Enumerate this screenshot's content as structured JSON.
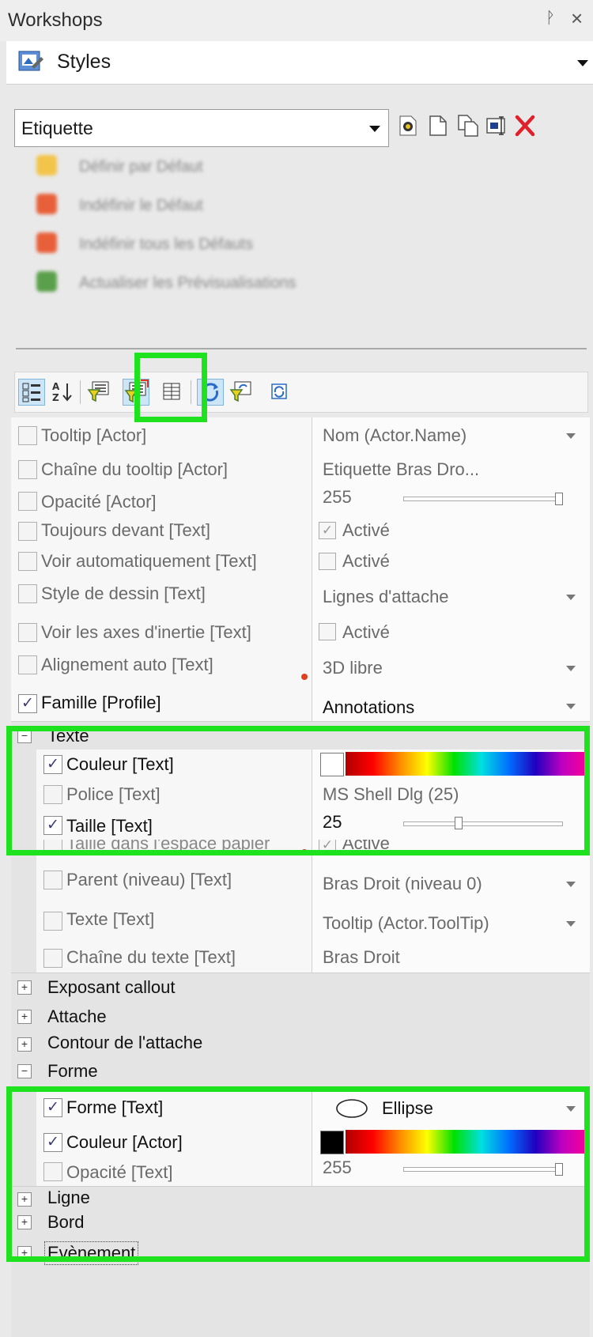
{
  "window": {
    "title": "Workshops",
    "pin_glyph": "ᚹ",
    "close_glyph": "×"
  },
  "styles_combo": {
    "label": "Styles",
    "icon": "styles-workshop-icon"
  },
  "style_selector": {
    "value": "Etiquette",
    "toolbar_icons": [
      "edit-style-icon",
      "new-style-icon",
      "copy-style-icon",
      "rename-style-icon",
      "delete-style-icon"
    ]
  },
  "blurred_actions": [
    {
      "label": "Définir par Défaut",
      "icon_color": "#f3c44a"
    },
    {
      "label": "Indéfinir le Défaut",
      "icon_color": "#e8603a"
    },
    {
      "label": "Indéfinir tous les Défauts",
      "icon_color": "#e8603a"
    },
    {
      "label": "Actualiser les Prévisualisations",
      "icon_color": "#5aa04a"
    }
  ],
  "property_toolbar": {
    "icons": [
      "categorized-icon",
      "alphabetical-icon",
      "filter-icon",
      "filter-highlighted-icon",
      "table-icon",
      "refresh-icon",
      "filter-refresh-icon",
      "sync-icon"
    ]
  },
  "grid": {
    "rows": [
      {
        "label": "Tooltip [Actor]",
        "checked": false,
        "value": "Nom (Actor.Name)",
        "dropdown": true
      },
      {
        "label": "Chaîne du tooltip [Actor]",
        "checked": false,
        "value": "Etiquette Bras Dro..."
      },
      {
        "label": "Opacité [Actor]",
        "checked": false,
        "value": "255",
        "slider": true,
        "slider_fraction": 1.0
      },
      {
        "label": "Toujours devant [Text]",
        "checked": false,
        "value": "Activé",
        "value_checkbox": true,
        "value_checked": true
      },
      {
        "label": "Voir automatiquement [Text]",
        "checked": false,
        "value": "Activé",
        "value_checkbox": true,
        "value_checked": false
      },
      {
        "label": "Style de dessin [Text]",
        "checked": false,
        "value": "Lignes d'attache",
        "dropdown": true
      },
      {
        "label": "Voir les axes d'inertie [Text]",
        "checked": false,
        "value": "Activé",
        "value_checkbox": true,
        "value_checked": false
      },
      {
        "label": "Alignement auto [Text]",
        "checked": false,
        "value": "3D libre",
        "dropdown": true
      },
      {
        "label": "Famille [Profile]",
        "checked": true,
        "value": "Annotations",
        "dropdown": true
      }
    ],
    "texte_category": {
      "label": "Texte",
      "expanded": true
    },
    "texte_rows": [
      {
        "label": "Couleur [Text]",
        "checked": true,
        "color": "#ffffff",
        "colorbar": true
      },
      {
        "label": "Police [Text]",
        "checked": false,
        "value": "MS Shell Dlg (25)"
      },
      {
        "label": "Taille [Text]",
        "checked": true,
        "value": "25",
        "slider": true,
        "slider_fraction": 0.36
      },
      {
        "label": "Taille dans l'espace papier",
        "checked": false,
        "value": "Activé",
        "value_checkbox": true,
        "value_checked": true
      },
      {
        "label": "Parent (niveau) [Text]",
        "checked": false,
        "value": "Bras Droit (niveau 0)",
        "dropdown": true
      },
      {
        "label": "Texte [Text]",
        "checked": false,
        "value": "Tooltip (Actor.ToolTip)",
        "dropdown": true
      },
      {
        "label": "Chaîne du texte [Text]",
        "checked": false,
        "value": "Bras Droit"
      }
    ],
    "collapsed_categories": [
      "Exposant callout",
      "Attache",
      "Contour de l'attache"
    ],
    "forme_category": {
      "label": "Forme",
      "expanded": true
    },
    "forme_rows": [
      {
        "label": "Forme [Text]",
        "checked": true,
        "value": "Ellipse",
        "dropdown": true,
        "shape_icon": "ellipse-icon"
      },
      {
        "label": "Couleur [Actor]",
        "checked": true,
        "color": "#000000",
        "colorbar": true
      },
      {
        "label": "Opacité [Text]",
        "checked": false,
        "value": "255",
        "slider": true,
        "slider_fraction": 1.0
      }
    ],
    "bottom_categories": [
      "Ligne",
      "Bord",
      "Evènement"
    ]
  },
  "expander": {
    "minus": "−",
    "plus": "+"
  },
  "check_glyph": "✓",
  "highlight_color": "#1ee21e"
}
